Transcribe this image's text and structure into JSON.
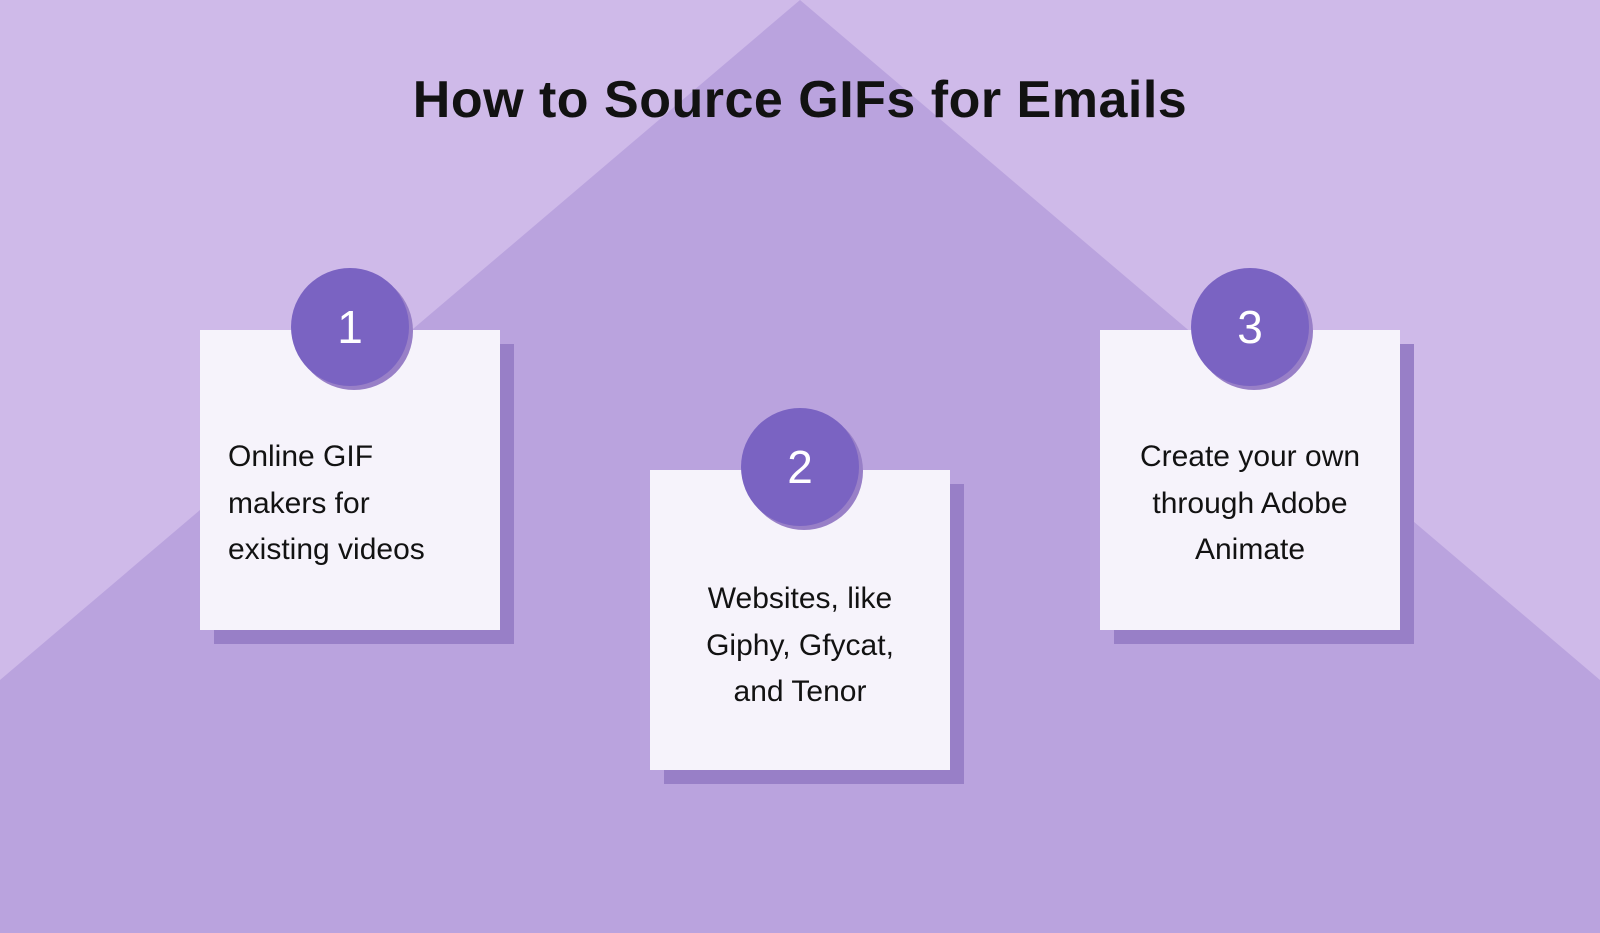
{
  "title": "How to Source GIFs for Emails",
  "cards": [
    {
      "num": "1",
      "text": "Online GIF makers for existing videos"
    },
    {
      "num": "2",
      "text": "Websites, like Giphy, Gfycat, and Tenor"
    },
    {
      "num": "3",
      "text": "Create your own through Adobe Animate"
    }
  ],
  "colors": {
    "bg": "#baa3de",
    "bg_light": "#cfbae9",
    "card": "#f6f3fb",
    "shadow": "#987fc7",
    "badge": "#7a63c2",
    "text": "#121212"
  }
}
